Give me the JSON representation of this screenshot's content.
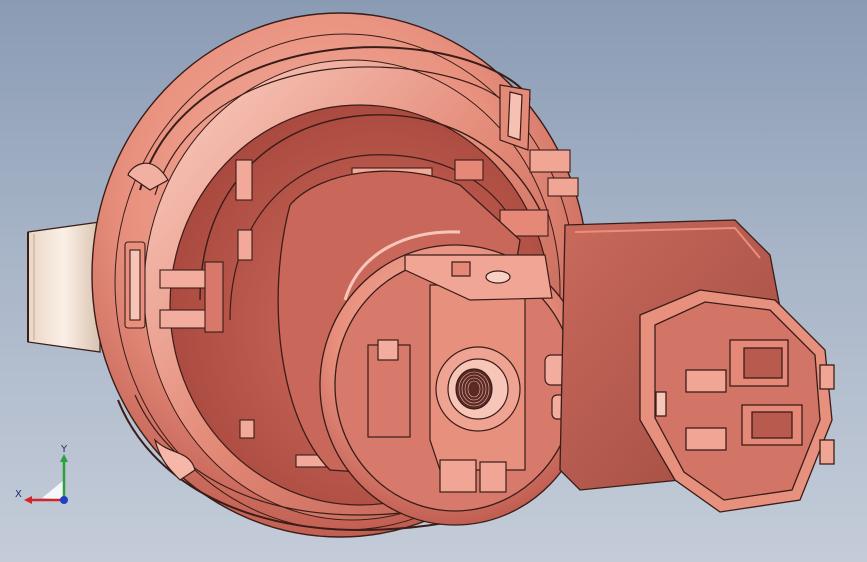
{
  "viewport": {
    "background_top": "#8a9bb4",
    "background_bottom": "#c4ccd8",
    "part_color": "#e8907e",
    "part_shadow": "#b9554a",
    "part_highlight": "#f8c3b6",
    "edge_color": "#3a1d18",
    "cap_color": "#f3e6d9"
  },
  "triad": {
    "x_label": "X",
    "y_label": "Y",
    "x_color": "#d0262a",
    "y_color": "#2aa13a",
    "z_color": "#2040c0"
  }
}
